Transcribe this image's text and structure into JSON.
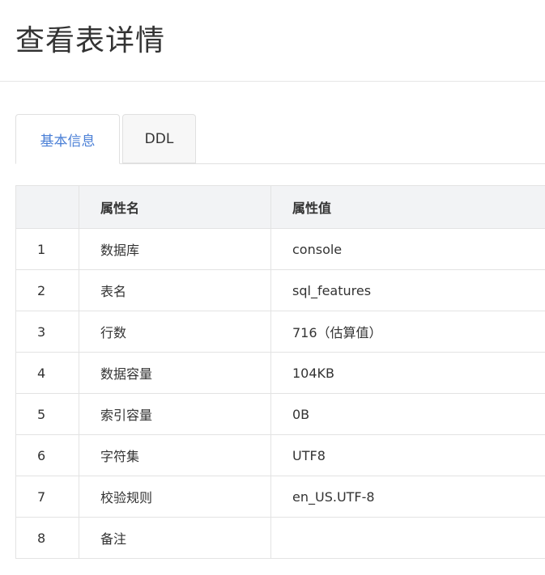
{
  "page": {
    "title": "查看表详情"
  },
  "tabs": [
    {
      "label": "基本信息",
      "active": true
    },
    {
      "label": "DDL",
      "active": false
    }
  ],
  "table": {
    "columns": [
      "",
      "属性名",
      "属性值"
    ],
    "rows": [
      {
        "index": "1",
        "name": "数据库",
        "value": "console"
      },
      {
        "index": "2",
        "name": "表名",
        "value": "sql_features"
      },
      {
        "index": "3",
        "name": "行数",
        "value": "716（估算值）"
      },
      {
        "index": "4",
        "name": "数据容量",
        "value": "104KB"
      },
      {
        "index": "5",
        "name": "索引容量",
        "value": "0B"
      },
      {
        "index": "6",
        "name": "字符集",
        "value": "UTF8"
      },
      {
        "index": "7",
        "name": "校验规则",
        "value": "en_US.UTF-8"
      },
      {
        "index": "8",
        "name": "备注",
        "value": ""
      }
    ]
  },
  "colors": {
    "accent": "#4a7fd6",
    "header_bg": "#f2f3f5",
    "border": "#e3e3e3"
  }
}
